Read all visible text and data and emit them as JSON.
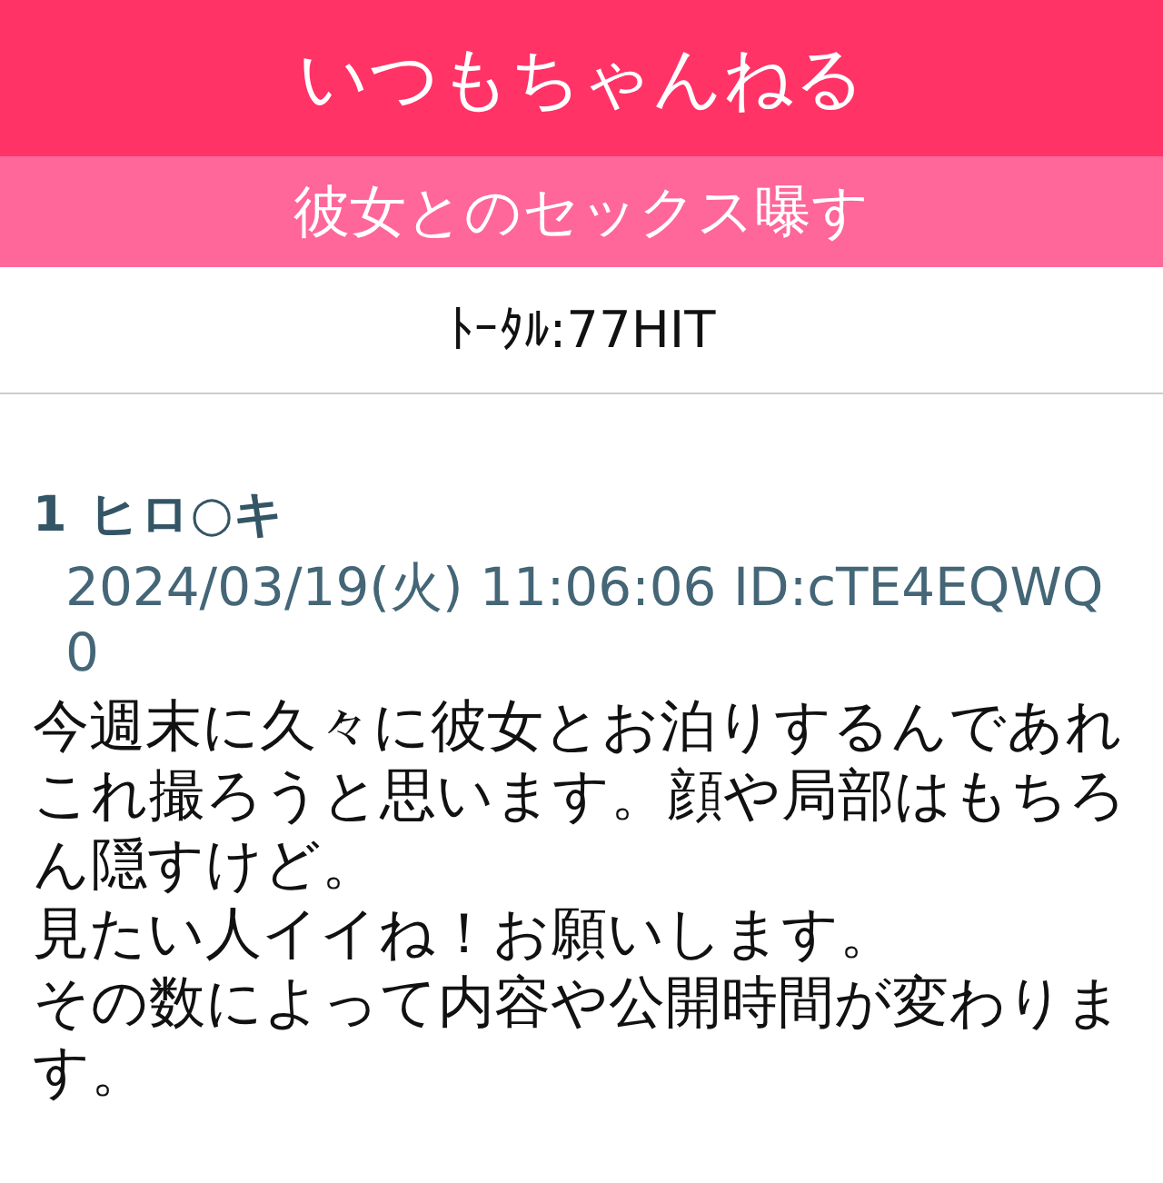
{
  "header": {
    "title": "いつもちゃんねる"
  },
  "thread": {
    "title": "彼女とのセックス曝す"
  },
  "counter": {
    "text": "ﾄｰﾀﾙ:77HIT"
  },
  "posts": [
    {
      "number": "1",
      "name": "ヒロ○キ",
      "meta": "2024/03/19(火) 11:06:06 ID:cTE4EQWQ0",
      "body": [
        "今週末に久々に彼女とお泊りするんであれこれ撮ろうと思います。顔や局部はもちろん隠すけど。",
        "見たい人イイね！お願いします。",
        "その数によって内容や公開時間が変わります。"
      ]
    }
  ]
}
